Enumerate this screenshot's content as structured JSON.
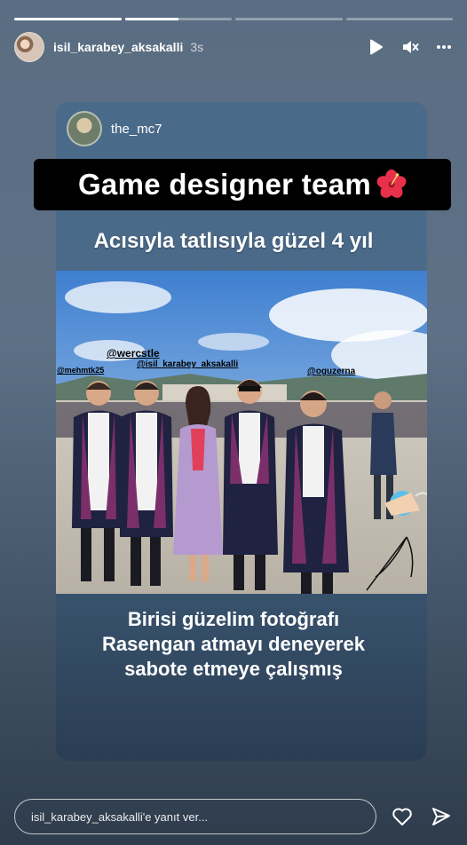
{
  "story": {
    "progress": [
      1,
      0.5,
      0,
      0
    ],
    "username": "isil_karabey_aksakalli",
    "time": "3s"
  },
  "icons": {
    "play": "play-icon",
    "mute": "mute-icon",
    "more": "more-icon",
    "like": "heart-icon",
    "share": "send-icon"
  },
  "card": {
    "username": "the_mc7",
    "banner": "Game designer team",
    "banner_emoji": "hibiscus",
    "subtitle": "Acısıyla tatlısıyla güzel 4 yıl",
    "tags": {
      "wercstle": "@wercstle",
      "mehmtk": "@mehmtk25",
      "isil": "@isil_karabey_aksakalli",
      "oguzerna": "@oguzerna"
    },
    "caption": [
      "Birisi güzelim fotoğrafı",
      "Rasengan atmayı deneyerek",
      "sabote etmeye çalışmış"
    ]
  },
  "footer": {
    "reply_placeholder": "isil_karabey_aksakalli'e yanıt ver..."
  }
}
